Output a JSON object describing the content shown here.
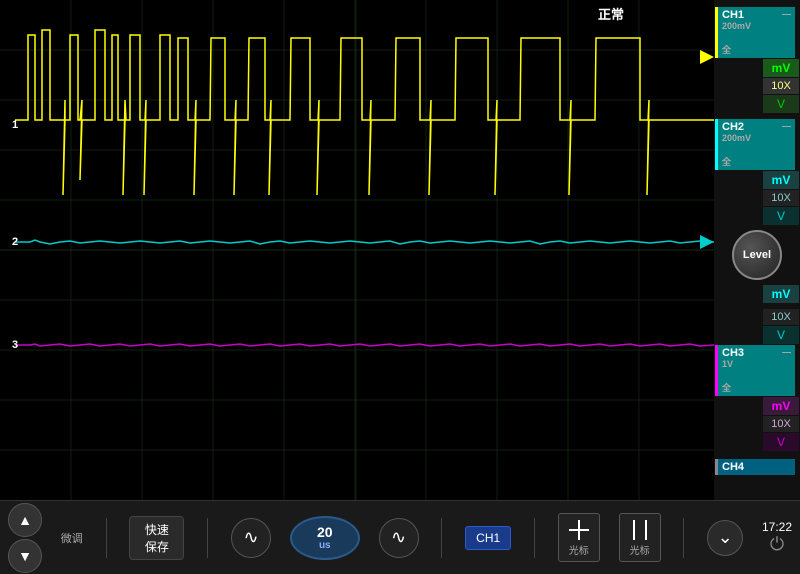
{
  "display": {
    "status": "正常",
    "grid_color": "#1a3a1a",
    "bg_color": "#000000"
  },
  "channels": {
    "ch1": {
      "label": "CH1",
      "sublabel": "200mV",
      "sub2": "全",
      "color": "#ffff00",
      "indicator": "►",
      "mV_label": "mV",
      "xn_label": "10X",
      "v_label": "V"
    },
    "ch2": {
      "label": "CH2",
      "sublabel": "200mV",
      "sub2": "全",
      "color": "#00ffff",
      "mV_label": "mV",
      "xn_label": "10X",
      "v_label": "V"
    },
    "ch3": {
      "label": "CH3",
      "sublabel": "1V",
      "sub2": "全",
      "color": "#ff00ff",
      "mV_label": "mV",
      "xn_label": "10X",
      "v_label": "V"
    },
    "ch4": {
      "label": "CH4",
      "color": "#888888"
    }
  },
  "level_knob": {
    "label": "Level"
  },
  "toolbar": {
    "down_arrow_label": "▼",
    "up_arrow_label": "▲",
    "fine_tune_label": "微调",
    "fast_save_label": "快速\n保存",
    "wave1_icon": "∿",
    "time_value": "20",
    "time_unit": "us",
    "wave2_icon": "∿",
    "ch1_btn_label": "CH1",
    "cursor1_label": "光标",
    "cursor2_label": "光标",
    "time_display": "17:22",
    "ch_indicator": "CHI"
  },
  "channel_numbers": {
    "ch1_num": "1",
    "ch2_num": "2",
    "ch3_num": "3"
  }
}
